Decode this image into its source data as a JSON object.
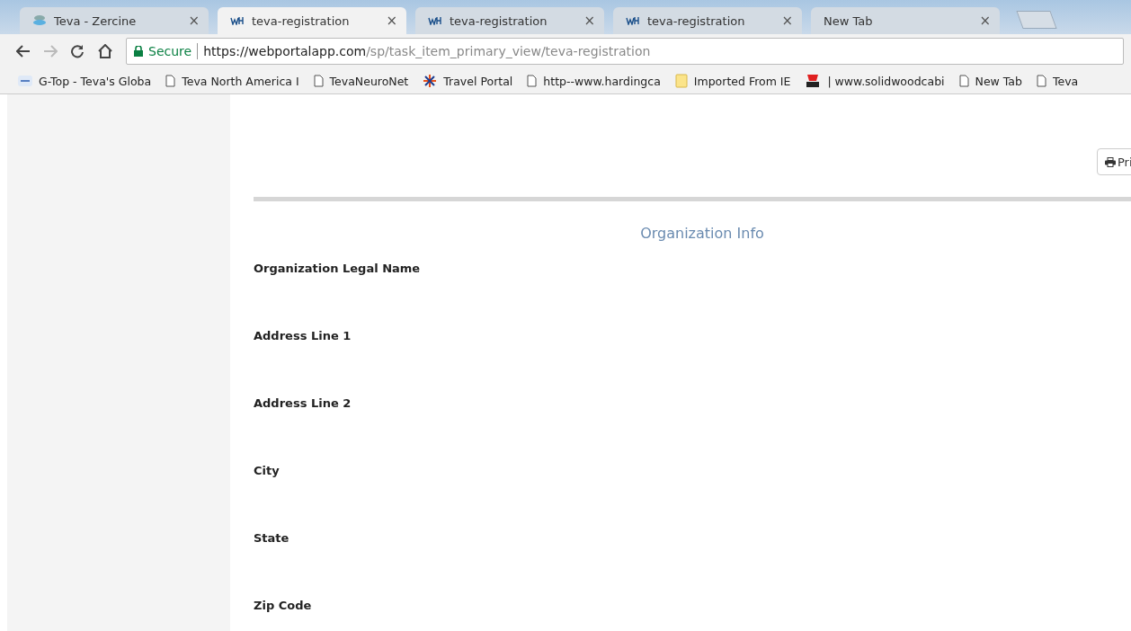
{
  "tabs": [
    {
      "title": "Teva - Zercine",
      "kind": "stack",
      "selected": false,
      "close": "×"
    },
    {
      "title": "teva-registration",
      "kind": "wh",
      "selected": true,
      "close": "×"
    },
    {
      "title": "teva-registration",
      "kind": "wh",
      "selected": false,
      "close": "×"
    },
    {
      "title": "teva-registration",
      "kind": "wh",
      "selected": false,
      "close": "×"
    },
    {
      "title": "New Tab",
      "kind": "plain",
      "selected": false,
      "close": "×"
    }
  ],
  "address_bar": {
    "secure_label": "Secure",
    "url_host": "https://webportalapp.com",
    "url_path": "/sp/task_item_primary_view/teva-registration"
  },
  "bookmarks": [
    {
      "label": "G-Top - Teva's Globa",
      "kind": "link"
    },
    {
      "label": "Teva North America I",
      "kind": "page"
    },
    {
      "label": "TevaNeuroNet",
      "kind": "page"
    },
    {
      "label": "Travel Portal",
      "kind": "star"
    },
    {
      "label": "http--www.hardingca",
      "kind": "page"
    },
    {
      "label": "Imported From IE",
      "kind": "folder"
    },
    {
      "label": "| www.solidwoodcabi",
      "kind": "sw"
    },
    {
      "label": "New Tab",
      "kind": "page"
    },
    {
      "label": "Teva",
      "kind": "page"
    }
  ],
  "print_button": {
    "label": "Pri"
  },
  "section_title": "Organization Info",
  "fields": [
    "Organization Legal Name",
    "Address Line 1",
    "Address Line 2",
    "City",
    "State",
    "Zip Code"
  ]
}
